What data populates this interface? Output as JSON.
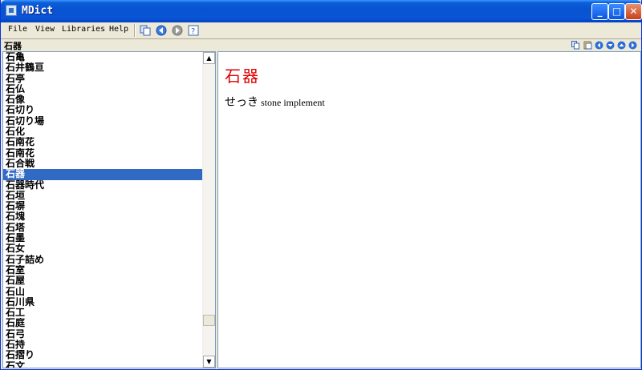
{
  "window": {
    "title": "MDict"
  },
  "menu": [
    {
      "label": "File",
      "key": "file"
    },
    {
      "label": "View",
      "key": "view"
    },
    {
      "label": "Libraries",
      "key": "libraries"
    },
    {
      "label": "Help",
      "key": "help"
    }
  ],
  "search": {
    "value": "石器"
  },
  "word_list": [
    "石亀",
    "石井鶴亘",
    "石亭",
    "石仏",
    "石像",
    "石切り",
    "石切り場",
    "石化",
    "石南花",
    "石南花",
    "石合戦",
    "石器",
    "石器時代",
    "石垣",
    "石塀",
    "石塊",
    "石塔",
    "石墨",
    "石女",
    "石子詰め",
    "石室",
    "石屋",
    "石山",
    "石川県",
    "石工",
    "石庭",
    "石弓",
    "石持",
    "石摺り",
    "石文"
  ],
  "selected_index": 11,
  "entry": {
    "headword": "石器",
    "reading": "せっき",
    "meaning": "stone implement"
  },
  "colors": {
    "headword": "#e00000",
    "selection": "#316ac5",
    "titlebar": "#0a55d6"
  }
}
